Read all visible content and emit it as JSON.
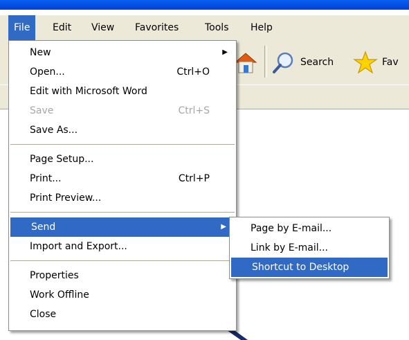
{
  "menubar": {
    "items": [
      {
        "label": "File"
      },
      {
        "label": "Edit"
      },
      {
        "label": "View"
      },
      {
        "label": "Favorites"
      },
      {
        "label": "Tools"
      },
      {
        "label": "Help"
      }
    ]
  },
  "toolbar": {
    "search_label": "Search",
    "favorites_label": "Fav"
  },
  "file_menu": {
    "new": "New",
    "open": "Open...",
    "open_shortcut": "Ctrl+O",
    "edit_word": "Edit with Microsoft Word",
    "save": "Save",
    "save_shortcut": "Ctrl+S",
    "save_as": "Save As...",
    "page_setup": "Page Setup...",
    "print": "Print...",
    "print_shortcut": "Ctrl+P",
    "print_preview": "Print Preview...",
    "send": "Send",
    "import_export": "Import and Export...",
    "properties": "Properties",
    "work_offline": "Work Offline",
    "close": "Close"
  },
  "send_menu": {
    "page_email": "Page by E-mail...",
    "link_email": "Link by E-mail...",
    "shortcut_desktop": "Shortcut to Desktop"
  },
  "colors": {
    "highlight": "#316ac5",
    "chrome": "#ece9d8",
    "disabled": "#a7a6aa"
  }
}
